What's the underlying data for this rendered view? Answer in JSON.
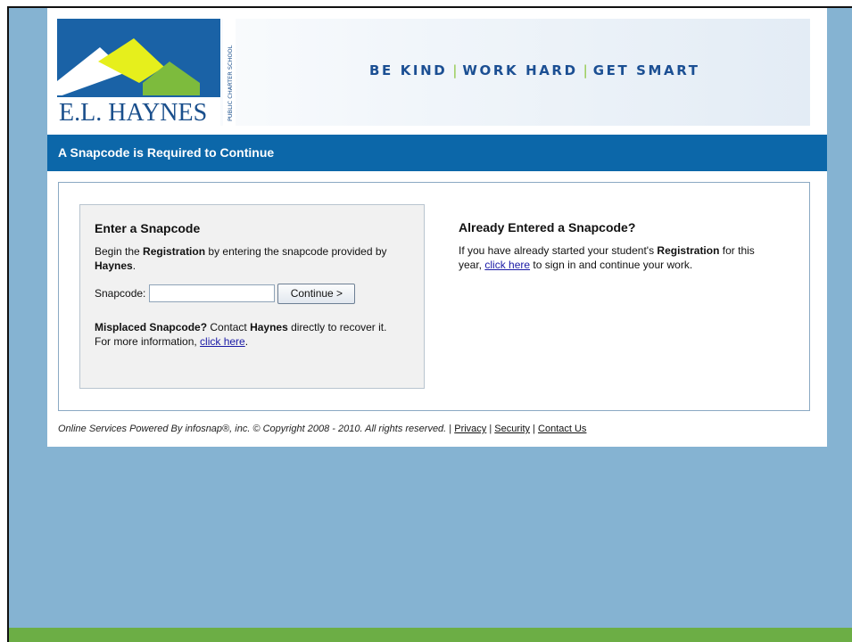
{
  "logo": {
    "name": "E.L. HAYNES",
    "tagline": "PUBLIC CHARTER SCHOOL"
  },
  "slogan": [
    "BE KIND",
    "WORK HARD",
    "GET SMART"
  ],
  "title_bar": "A Snapcode is Required to Continue",
  "enter_panel": {
    "heading": "Enter a Snapcode",
    "desc_pre": "Begin the ",
    "desc_bold1": "Registration",
    "desc_mid": " by entering the snapcode provided by ",
    "desc_bold2": "Haynes",
    "desc_end": ".",
    "field_label": "Snapcode:",
    "field_value": "",
    "button_label": "Continue >",
    "misplaced_bold": "Misplaced Snapcode?",
    "misplaced_mid": " Contact ",
    "misplaced_bold2": "Haynes",
    "misplaced_end": " directly to recover it.",
    "more_pre": "For more information, ",
    "more_link": "click here",
    "more_end": "."
  },
  "already_panel": {
    "heading": "Already Entered a Snapcode?",
    "text_pre": "If you have already started your student's ",
    "text_bold": "Registration",
    "text_mid": " for this year, ",
    "link": "click here",
    "text_end": " to sign in and continue your work."
  },
  "footer": {
    "copyright": "Online Services Powered By infosnap®, inc. © Copyright 2008 - 2010. All rights reserved.",
    "sep": " | ",
    "links": [
      "Privacy",
      "Security",
      "Contact Us"
    ]
  },
  "colors": {
    "background": "#85b3d2",
    "title_bar": "#0c67a9",
    "slogan": "#1b4f93",
    "bottom_bar": "#6cae45"
  }
}
